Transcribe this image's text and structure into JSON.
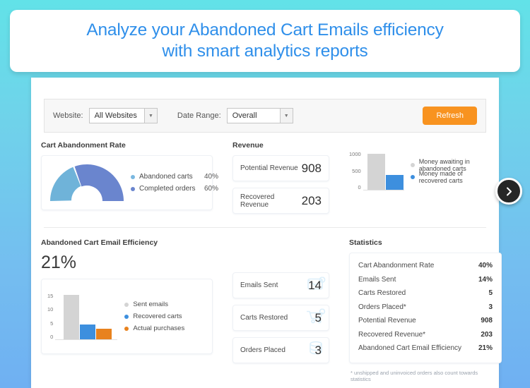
{
  "banner": {
    "line1": "Analyze your Abandoned Cart Emails efficiency",
    "line2": "with smart analytics reports",
    "color": "#2f8fea"
  },
  "filters": {
    "website_label": "Website:",
    "website_value": "All Websites",
    "date_label": "Date Range:",
    "date_value": "Overall",
    "refresh_label": "Refresh",
    "refresh_color": "#f89320"
  },
  "sections": {
    "abandonment": "Cart Abandonment Rate",
    "revenue": "Revenue",
    "efficiency": "Abandoned Cart Email Efficiency",
    "statistics": "Statistics"
  },
  "efficiency_value": "21%",
  "metrics": {
    "potential_revenue": {
      "label": "Potential Revenue",
      "value": "908"
    },
    "recovered_revenue": {
      "label": "Recovered Revenue",
      "value": "203"
    },
    "emails_sent": {
      "label": "Emails Sent",
      "value": "14",
      "icon": "envelope-icon"
    },
    "carts_restored": {
      "label": "Carts Restored",
      "value": "5",
      "icon": "shopping-cart-icon"
    },
    "orders_placed": {
      "label": "Orders Placed",
      "value": "3",
      "icon": "coins-icon"
    }
  },
  "statistics": {
    "rows": [
      {
        "label": "Cart Abandonment Rate",
        "value": "40%"
      },
      {
        "label": "Emails Sent",
        "value": "14%"
      },
      {
        "label": "Carts Restored",
        "value": "5"
      },
      {
        "label": "Orders Placed*",
        "value": "3"
      },
      {
        "label": "Potential Revenue",
        "value": "908"
      },
      {
        "label": "Recovered Revenue*",
        "value": "203"
      },
      {
        "label": "Abandoned Cart Email Efficiency",
        "value": "21%"
      }
    ],
    "footnote": "* unshipped and uninvoiced orders also count towards statistics"
  },
  "next_button": {
    "icon": "chevron-right-icon"
  },
  "chart_data": [
    {
      "type": "pie",
      "title": "Cart Abandonment Rate",
      "subtype": "half-donut-gauge",
      "labels": [
        "Abandoned carts",
        "Completed orders"
      ],
      "values": [
        40,
        60
      ],
      "display_values": [
        "40%",
        "60%"
      ],
      "colors": [
        "#6fb3d9",
        "#6a85ce"
      ],
      "legend": "right"
    },
    {
      "type": "bar",
      "title": "Revenue",
      "categories": [
        "Money awaiting in abandoned carts",
        "Money made of recovered carts"
      ],
      "values": [
        908,
        380
      ],
      "colors": [
        "#d4d4d4",
        "#3d8fde"
      ],
      "ylabel": "",
      "xlabel": "",
      "yticks": [
        0,
        500,
        1000
      ],
      "ylim": [
        0,
        1000
      ],
      "grid": false,
      "legend": "right"
    },
    {
      "type": "bar",
      "title": "Abandoned Cart Email Efficiency",
      "categories": [
        "Sent emails",
        "Recovered carts",
        "Actual purchases"
      ],
      "values": [
        15,
        5,
        3.5
      ],
      "colors": [
        "#d4d4d4",
        "#3d8fde",
        "#e8821e"
      ],
      "ylabel": "",
      "xlabel": "",
      "yticks": [
        0,
        5,
        10,
        15
      ],
      "ylim": [
        0,
        16
      ],
      "grid": false,
      "legend": "right"
    }
  ]
}
